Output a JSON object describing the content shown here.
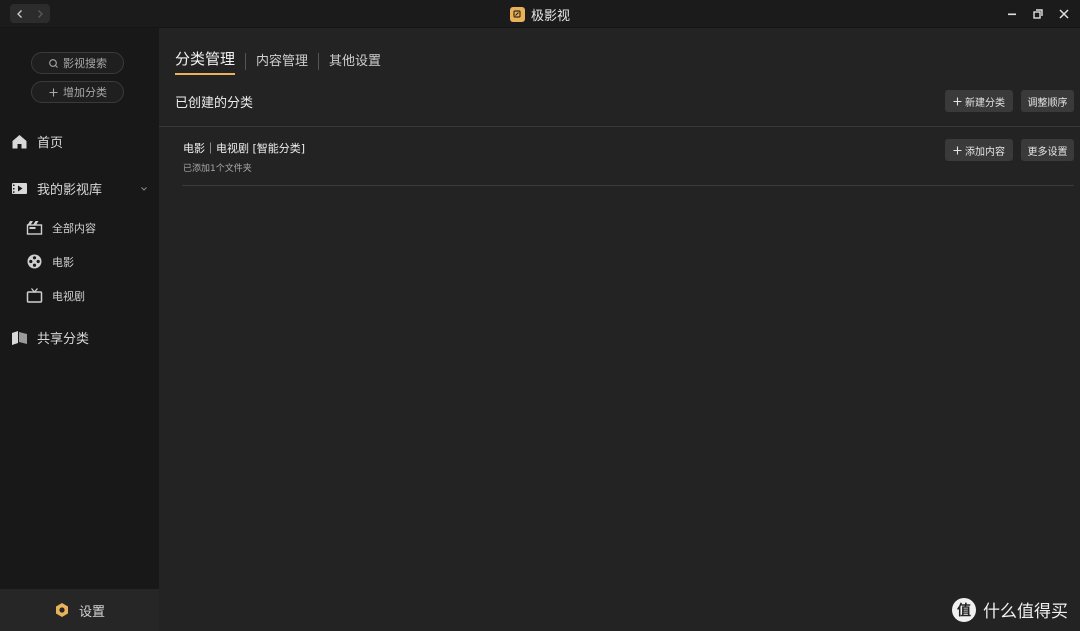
{
  "window": {
    "title": "极影视",
    "colors": {
      "accent": "#e9b15a",
      "sidebar": "#181818",
      "main": "#232323"
    }
  },
  "sidebar": {
    "search_label": "影视搜索",
    "add_category_label": "增加分类",
    "home_label": "首页",
    "library_label": "我的影视库",
    "library_items": [
      {
        "label": "全部内容",
        "icon": "clapperboard-icon"
      },
      {
        "label": "电影",
        "icon": "film-reel-icon"
      },
      {
        "label": "电视剧",
        "icon": "tv-icon"
      }
    ],
    "shared_label": "共享分类",
    "settings_label": "设置"
  },
  "main": {
    "tabs": [
      {
        "label": "分类管理",
        "active": true
      },
      {
        "label": "内容管理",
        "active": false
      },
      {
        "label": "其他设置",
        "active": false
      }
    ],
    "section_title": "已创建的分类",
    "new_category_label": "新建分类",
    "reorder_label": "调整顺序",
    "categories": [
      {
        "name": "电影｜电视剧 [智能分类]",
        "meta": "已添加1个文件夹",
        "add_content_label": "添加内容",
        "more_settings_label": "更多设置"
      }
    ]
  },
  "watermark": {
    "logo_char": "值",
    "text": "什么值得买"
  }
}
